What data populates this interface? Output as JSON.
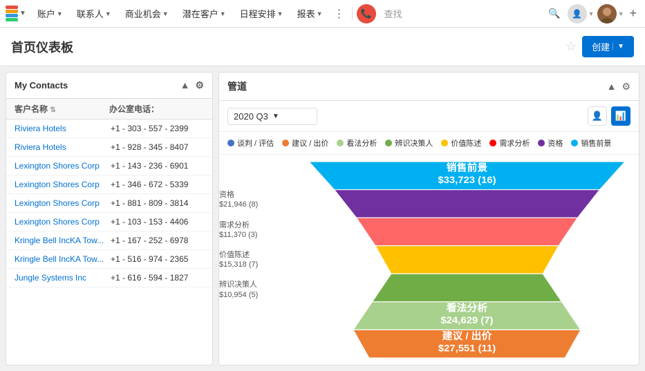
{
  "nav": {
    "items": [
      {
        "label": "账户",
        "hasArrow": true
      },
      {
        "label": "联系人",
        "hasArrow": true
      },
      {
        "label": "商业机会",
        "hasArrow": true
      },
      {
        "label": "潜在客户",
        "hasArrow": true
      },
      {
        "label": "日程安排",
        "hasArrow": true
      },
      {
        "label": "报表",
        "hasArrow": true
      }
    ],
    "search_placeholder": "查找",
    "plus_label": "+"
  },
  "page": {
    "title": "首页仪表板",
    "create_label": "创建"
  },
  "left_panel": {
    "title": "My Contacts",
    "col_name": "客户名称",
    "col_phone": "办公室电话：",
    "contacts": [
      {
        "name": "Riviera Hotels",
        "phone": "+1 - 303 - 557 - 2399"
      },
      {
        "name": "Riviera Hotels",
        "phone": "+1 - 928 - 345 - 8407"
      },
      {
        "name": "Lexington Shores Corp",
        "phone": "+1 - 143 - 236 - 6901"
      },
      {
        "name": "Lexington Shores Corp",
        "phone": "+1 - 346 - 672 - 5339"
      },
      {
        "name": "Lexington Shores Corp",
        "phone": "+1 - 881 - 809 - 3814"
      },
      {
        "name": "Lexington Shores Corp",
        "phone": "+1 - 103 - 153 - 4406"
      },
      {
        "name": "Kringle Bell IncKA Tow...",
        "phone": "+1 - 167 - 252 - 6978"
      },
      {
        "name": "Kringle Bell IncKA Tow...",
        "phone": "+1 - 516 - 974 - 2365"
      },
      {
        "name": "Jungle Systems Inc",
        "phone": "+1 - 616 - 594 - 1827"
      }
    ]
  },
  "right_panel": {
    "title": "管道",
    "quarter": "2020 Q3",
    "legend": [
      {
        "label": "谈判 / 评估",
        "color": "#4472C4"
      },
      {
        "label": "建议 / 出价",
        "color": "#ED7D31"
      },
      {
        "label": "看法分析",
        "color": "#A9D18E"
      },
      {
        "label": "辨识决策人",
        "color": "#70AD47"
      },
      {
        "label": "价值陈述",
        "color": "#FFC000"
      },
      {
        "label": "需求分析",
        "color": "#FF0000"
      },
      {
        "label": "资格",
        "color": "#7030A0"
      },
      {
        "label": "销售前景",
        "color": "#00B0F0"
      }
    ],
    "funnel": {
      "layers": [
        {
          "label": "销售前景",
          "value": "$33,723 (16)",
          "color": "#00B0F0",
          "widthPct": 100,
          "inside": true
        },
        {
          "label": "资格",
          "value": "$21,946 (8)",
          "color": "#7030A0",
          "widthPct": 84,
          "inside": false
        },
        {
          "label": "需求分析",
          "value": "$11,370 (3)",
          "color": "#FF6666",
          "widthPct": 70,
          "inside": false
        },
        {
          "label": "价值陈述",
          "value": "$15,318 (7)",
          "color": "#FFC000",
          "widthPct": 58,
          "inside": false
        },
        {
          "label": "辨识决策人",
          "value": "$10,954 (5)",
          "color": "#70AD47",
          "widthPct": 48,
          "inside": false
        },
        {
          "label": "看法分析",
          "value": "$24,629 (7)",
          "color": "#A9D18E",
          "widthPct": 60,
          "inside": true
        },
        {
          "label": "建议 / 出价",
          "value": "$27,551 (11)",
          "color": "#ED7D31",
          "widthPct": 72,
          "inside": true
        }
      ]
    }
  }
}
